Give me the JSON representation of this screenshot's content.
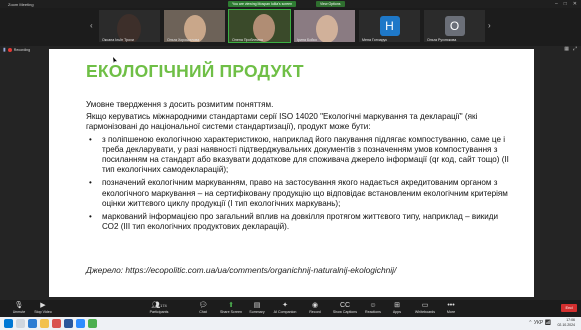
{
  "titlebar": {
    "app_title": "Zoom Meeting",
    "share_note": "You are viewing Mospan Iuliia's screen",
    "view_options": "View Options",
    "min": "–",
    "max": "□",
    "close": "✕"
  },
  "participants": [
    {
      "name": "Оксана Ільїн Трохи",
      "color": "#3d2f2a"
    },
    {
      "name": "Ольга Хорошилова",
      "color": "#5a4a3e"
    },
    {
      "name": "Олена Проблемна",
      "color": "#4b5a3a"
    },
    {
      "name": "Ірина Бойко",
      "color": "#6a5860"
    },
    {
      "name": "Мена Гончарук",
      "initial": "H",
      "color": "#1e78c8"
    },
    {
      "name": "Ольга Рухлюкова",
      "initial": "O",
      "color": "#6b6f78"
    }
  ],
  "recording": {
    "label": "Recording"
  },
  "slide": {
    "title": "ЕКОЛОГІЧНИЙ ПРОДУКТ",
    "intro": "Умовне твердження з досить розмитим поняттям.",
    "para": "Якщо керуватись міжнародними стандартами серії ISO 14020 \"Екологічні маркування та декларації\" (які гармонізовані до національної системи стандартизації), продукт може бути:",
    "bullets": [
      "з поліпшеною екологічною характеристикою, наприклад його пакування підлягає компостуванню, саме це і треба декларувати, у разі наявності підтверджувальних документів з позначенням умов компостування з посиланням на стандарт або вказувати додаткове для споживача джерело інформації (qr код, сайт тощо) (ІІ  тип екологічних самодекларацій);",
      "позначений  екологічним маркуванням, право на застосування якого надається акредитованим органом з екологічного маркування – на сертифіковану продукцію що відповідає встановленим екологічним критеріям оцінки життєвого циклу продукції (І тип екологічних маркувань);",
      "маркований інформацією про загальний вплив на довкілля протягом життєвого типу, наприклад – викиди СО2 (ІІІ тип екологічних продуктових декларацій)."
    ],
    "source": "Джерело: https://ecopolitic.com.ua/ua/comments/organichnij-naturalnij-ekologichnij/"
  },
  "toolbar": {
    "unmute": "Unmute",
    "stop_video": "Stop Video",
    "participants": "Participants",
    "participants_count": "174",
    "chat": "Chat",
    "share_screen": "Share Screen",
    "summary": "Summary",
    "ai_companion": "AI Companion",
    "record": "Record",
    "show_captions": "Show Captions",
    "reactions": "Reactions",
    "apps": "Apps",
    "whiteboards": "Whiteboards",
    "more": "More",
    "end": "End"
  },
  "taskbar": {
    "time": "17:06",
    "date": "02.10.2024",
    "lang": "УКР"
  }
}
